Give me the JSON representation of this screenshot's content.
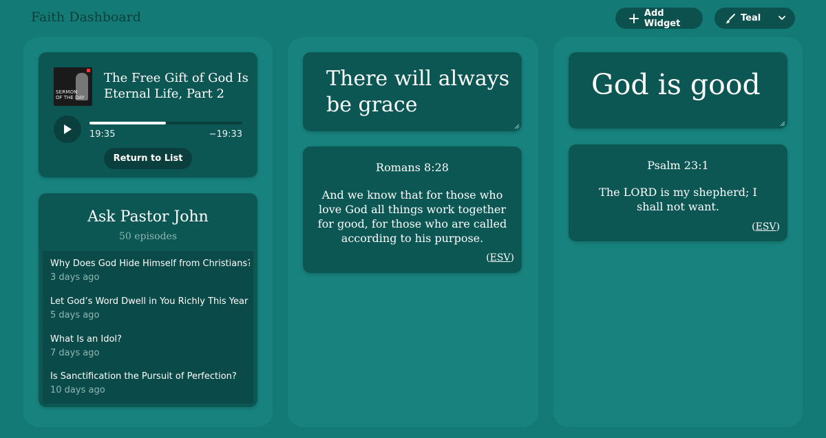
{
  "header": {
    "title": "Faith Dashboard",
    "add_widget_label": "Add Widget",
    "theme_label": "Teal"
  },
  "colors": {
    "background": "#147a75",
    "column": "#18837e",
    "card": "#0c5654",
    "button": "#0c514e",
    "muted_text": "#8fb8b5"
  },
  "player": {
    "title": "The Free Gift of God Is Eternal Life, Part 2",
    "artwork_text_line1": "SERMON",
    "artwork_text_line2": "OF THE DAY",
    "elapsed": "19:35",
    "remaining": "−19:33",
    "progress_fraction": 0.5,
    "return_label": "Return to List"
  },
  "episodes": {
    "title": "Ask Pastor John",
    "count": "50 episodes",
    "items": [
      {
        "name": "Why Does God Hide Himself from Christians?",
        "age": "3 days ago"
      },
      {
        "name": "Let God’s Word Dwell in You Richly This Year",
        "age": "5 days ago"
      },
      {
        "name": "What Is an Idol?",
        "age": "7 days ago"
      },
      {
        "name": "Is Sanctification the Pursuit of Perfection?",
        "age": "10 days ago"
      }
    ]
  },
  "notes": [
    {
      "text": "There will always be grace"
    },
    {
      "text": "God is good"
    }
  ],
  "verses": [
    {
      "reference": "Romans 8:28",
      "text": "And we know that for those who love God all things work together for good, for those who are called according to his purpose.",
      "source_open": "(",
      "source": "ESV",
      "source_close": ")"
    },
    {
      "reference": "Psalm 23:1",
      "text": "The LORD is my shepherd; I shall not want.",
      "source_open": "(",
      "source": "ESV",
      "source_close": ")"
    }
  ]
}
